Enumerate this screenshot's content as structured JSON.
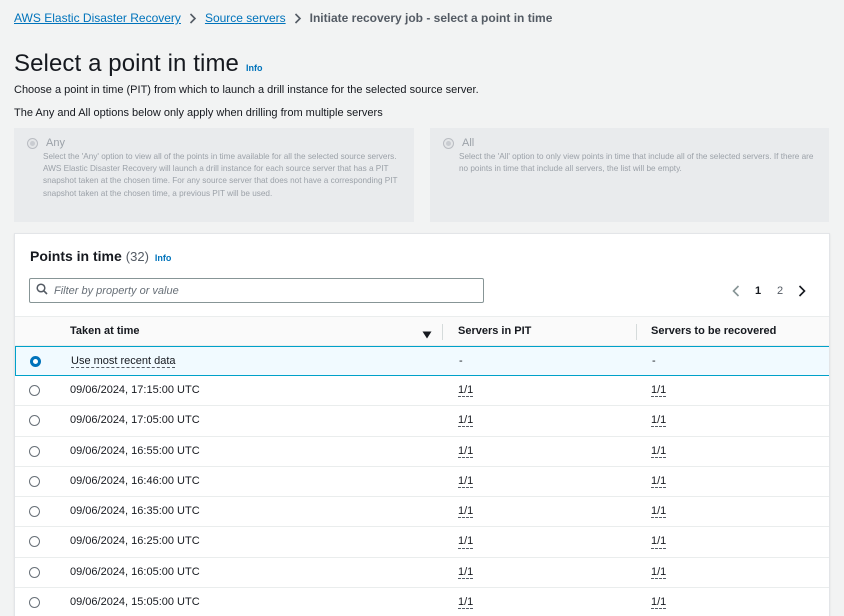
{
  "breadcrumb": {
    "items": [
      "AWS Elastic Disaster Recovery",
      "Source servers"
    ],
    "current": "Initiate recovery job - select a point in time"
  },
  "page": {
    "title": "Select a point in time",
    "info": "Info",
    "description_1": "Choose a point in time (PIT) from which to launch a drill instance for the selected source server.",
    "description_2": "The Any and All options below only apply when drilling from multiple servers"
  },
  "options": {
    "any": {
      "label": "Any",
      "text": "Select the 'Any' option to view all of the points in time available for all the selected source servers. AWS Elastic Disaster Recovery will launch a drill instance for each source server that has a PIT snapshot taken at the chosen time. For any source server that does not have a corresponding PIT snapshot taken at the chosen time, a previous PIT will be used."
    },
    "all": {
      "label": "All",
      "text": "Select the 'All' option to only view points in time that include all of the selected servers. If there are no points in time that include all servers, the list will be empty."
    }
  },
  "panel": {
    "title": "Points in time",
    "count": "(32)",
    "info": "Info",
    "filter_placeholder": "Filter by property or value",
    "pagination": {
      "pages": [
        "1",
        "2"
      ],
      "current": "1"
    }
  },
  "table": {
    "columns": [
      "Taken at time",
      "Servers in PIT",
      "Servers to be recovered"
    ],
    "rows": [
      {
        "time": "Use most recent data",
        "pit": "-",
        "recovered": "-",
        "selected": true
      },
      {
        "time": "09/06/2024, 17:15:00 UTC",
        "pit": "1/1",
        "recovered": "1/1"
      },
      {
        "time": "09/06/2024, 17:05:00 UTC",
        "pit": "1/1",
        "recovered": "1/1"
      },
      {
        "time": "09/06/2024, 16:55:00 UTC",
        "pit": "1/1",
        "recovered": "1/1"
      },
      {
        "time": "09/06/2024, 16:46:00 UTC",
        "pit": "1/1",
        "recovered": "1/1"
      },
      {
        "time": "09/06/2024, 16:35:00 UTC",
        "pit": "1/1",
        "recovered": "1/1"
      },
      {
        "time": "09/06/2024, 16:25:00 UTC",
        "pit": "1/1",
        "recovered": "1/1"
      },
      {
        "time": "09/06/2024, 16:05:00 UTC",
        "pit": "1/1",
        "recovered": "1/1"
      },
      {
        "time": "09/06/2024, 15:05:00 UTC",
        "pit": "1/1",
        "recovered": "1/1"
      }
    ]
  },
  "icons": {
    "breadcrumb_separator": "chevron-right-icon",
    "filter": "search-icon",
    "sort": "caret-down-icon",
    "prev_page": "chevron-left-icon",
    "next_page": "chevron-right-icon"
  },
  "colors": {
    "link": "#0073bb",
    "selected_row_border": "#00a1c9",
    "selected_row_bg": "#f1faff"
  }
}
